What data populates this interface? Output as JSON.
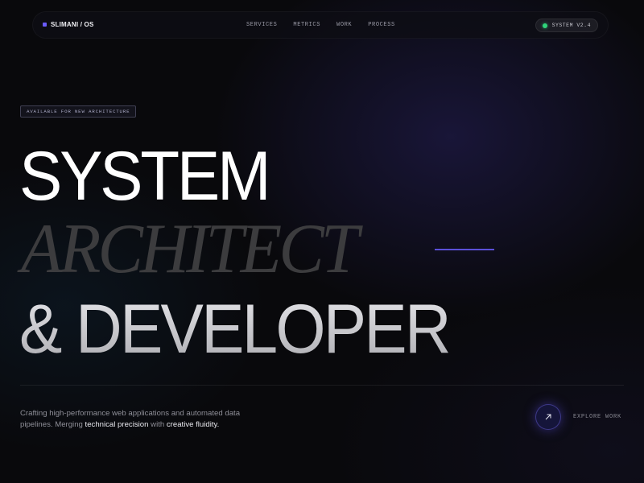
{
  "nav": {
    "brand": "SLIMANI / OS",
    "links": [
      "SERVICES",
      "METRICS",
      "WORK",
      "PROCESS"
    ],
    "status_label": "SYSTEM V2.4",
    "status_color": "#2fd57a"
  },
  "hero": {
    "badge": "AVAILABLE FOR NEW ARCHITECTURE",
    "line1": "SYSTEM",
    "line2": "ARCHITECT",
    "line3": "& DEVELOPER",
    "accent_color": "#5b4fd8"
  },
  "description": {
    "part1": "Crafting high-performance web applications and automated data pipelines. Merging ",
    "highlight1": "technical precision",
    "part2": " with ",
    "highlight2": "creative fluidity."
  },
  "cta": {
    "label": "EXPLORE WORK",
    "icon": "arrow-up-right-icon"
  }
}
